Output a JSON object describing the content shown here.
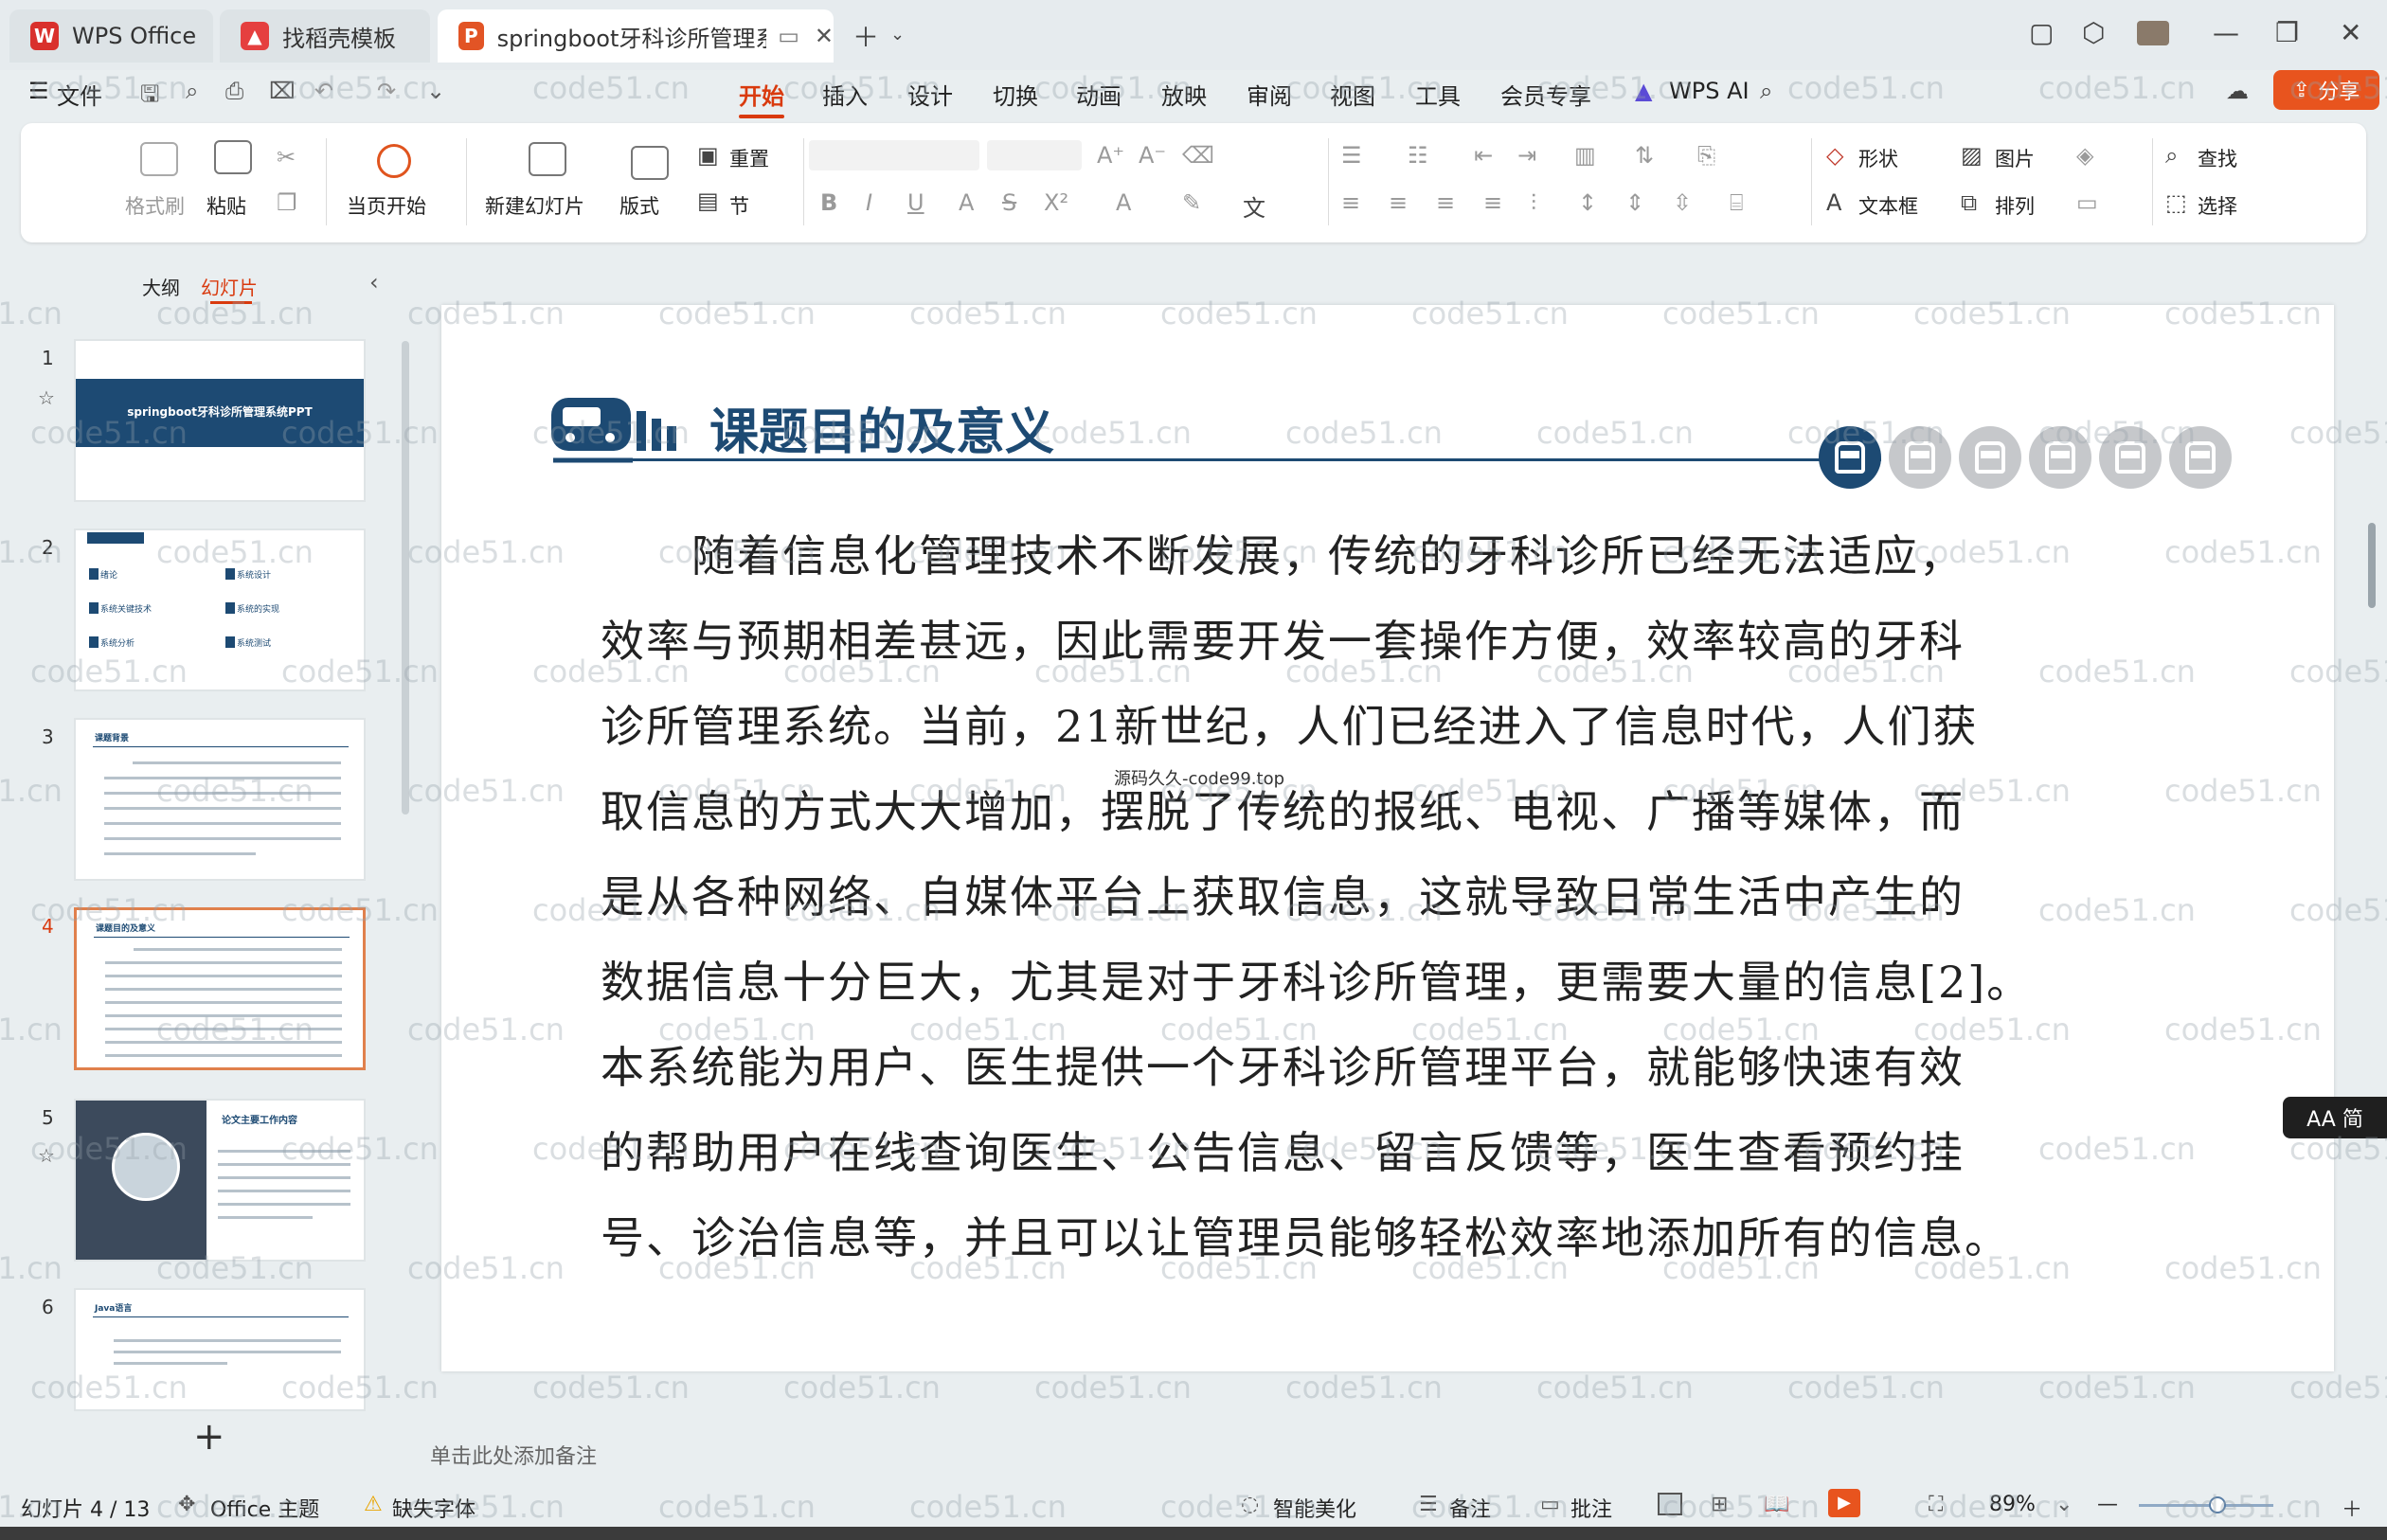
{
  "tabs": {
    "wps": "WPS Office",
    "daoke": "找稻壳模板",
    "doc": "springboot牙科诊所管理系统"
  },
  "menu": {
    "file": "文件",
    "items": [
      "开始",
      "插入",
      "设计",
      "切换",
      "动画",
      "放映",
      "审阅",
      "视图",
      "工具",
      "会员专享",
      "WPS AI"
    ],
    "share": "分享"
  },
  "ribbon": {
    "format_painter": "格式刷",
    "paste": "粘贴",
    "play_from_current": "当页开始",
    "new_slide": "新建幻灯片",
    "layout": "版式",
    "reset": "重置",
    "section": "节",
    "shape": "形状",
    "picture": "图片",
    "textbox": "文本框",
    "arrange": "排列",
    "find": "查找",
    "select": "选择"
  },
  "panel": {
    "outline": "大纲",
    "slides": "幻灯片",
    "add": "+"
  },
  "thumbnails": [
    {
      "num": "1",
      "text": "springboot牙科诊所管理系统PPT"
    },
    {
      "num": "2",
      "items": [
        "绪论",
        "系统设计",
        "系统关键技术",
        "系统的实现",
        "系统分析",
        "系统测试"
      ]
    },
    {
      "num": "3",
      "text": "课题背景"
    },
    {
      "num": "4",
      "text": "课题目的及意义"
    },
    {
      "num": "5",
      "text": "论文主要工作内容"
    },
    {
      "num": "6",
      "text": "Java语言"
    }
  ],
  "slide": {
    "title": "课题目的及意义",
    "caption": "源码久久-code99.top",
    "paragraph": [
      "　　随着信息化管理技术不断发展，传统的牙科诊所已经无法适应，",
      "效率与预期相差甚远，因此需要开发一套操作方便，效率较高的牙科",
      "诊所管理系统。当前，21新世纪，人们已经进入了信息时代，人们获",
      "取信息的方式大大增加，摆脱了传统的报纸、电视、广播等媒体，而",
      "是从各种网络、自媒体平台上获取信息，这就导致日常生活中产生的",
      "数据信息十分巨大，尤其是对于牙科诊所管理，更需要大量的信息[2]。",
      "本系统能为用户、医生提供一个牙科诊所管理平台，就能够快速有效",
      "的帮助用户在线查询医生、公告信息、留言反馈等，医生查看预约挂",
      "号、诊治信息等，并且可以让管理员能够轻松效率地添加所有的信息。"
    ]
  },
  "watermark": "code51.cn",
  "notes_placeholder": "单击此处添加备注",
  "lang_pill": "AA 简",
  "status": {
    "slide_counter": "幻灯片 4 / 13",
    "theme": "Office 主题",
    "missing_font": "缺失字体",
    "beautify": "智能美化",
    "notes": "备注",
    "comments": "批注",
    "zoom": "89%"
  },
  "colors": {
    "accent": "#d93a0e",
    "slide_blue": "#1d4a73",
    "share": "#e8541e"
  }
}
